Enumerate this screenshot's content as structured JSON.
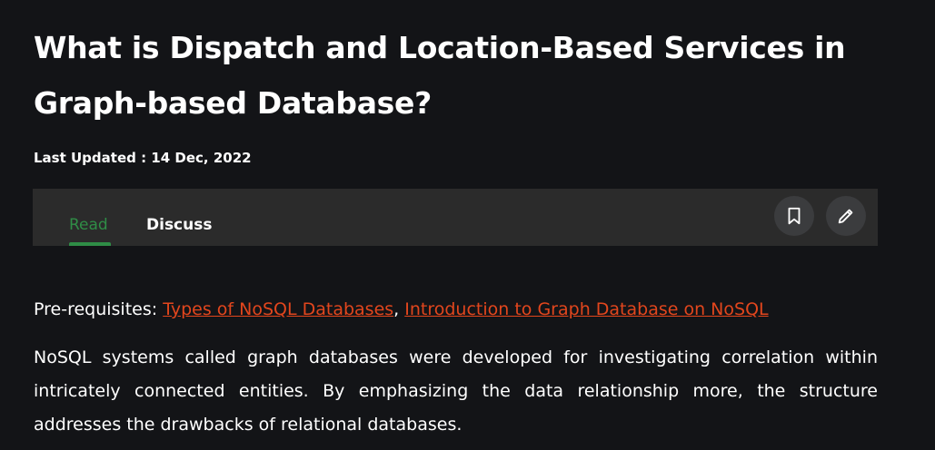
{
  "article": {
    "title": "What is Dispatch and Location-Based Services in Graph-based Database?",
    "last_updated": "Last Updated : 14 Dec, 2022"
  },
  "tabs": {
    "read_label": "Read",
    "discuss_label": "Discuss",
    "active": "Read",
    "bookmark_icon": "bookmark-icon",
    "edit_icon": "pencil-icon"
  },
  "content": {
    "prereq_label": "Pre-requisites: ",
    "prereq_links": [
      "Types of NoSQL Databases",
      "Introduction to Graph Database on NoSQL"
    ],
    "prereq_separator": ", ",
    "paragraph": "NoSQL systems called graph databases were developed for investigating correlation within intricately connected entities. By emphasizing the data relationship more, the structure addresses the drawbacks of relational databases."
  },
  "colors": {
    "background": "#131417",
    "tabbar": "#2b2b2b",
    "accent_green": "#2f8d46",
    "link": "#e2461d"
  }
}
